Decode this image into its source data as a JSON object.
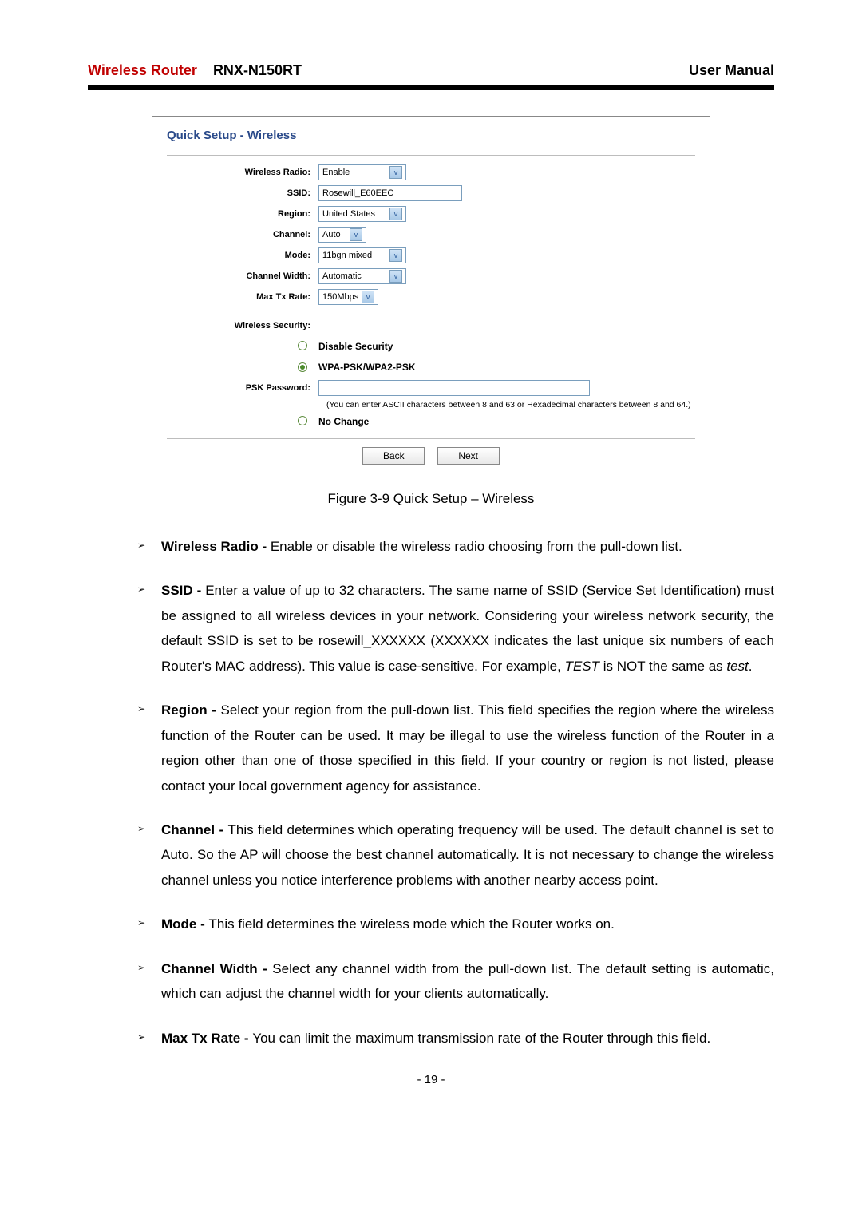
{
  "header": {
    "brand": "Wireless Router",
    "model": "RNX-N150RT",
    "right": "User Manual"
  },
  "figure": {
    "title": "Quick Setup - Wireless",
    "labels": {
      "wireless_radio": "Wireless Radio:",
      "ssid": "SSID:",
      "region": "Region:",
      "channel": "Channel:",
      "mode": "Mode:",
      "channel_width": "Channel Width:",
      "max_tx_rate": "Max Tx Rate:",
      "wireless_security": "Wireless Security:",
      "psk_password": "PSK Password:"
    },
    "values": {
      "wireless_radio": "Enable",
      "ssid": "Rosewill_E60EEC",
      "region": "United States",
      "channel": "Auto",
      "mode": "11bgn mixed",
      "channel_width": "Automatic",
      "max_tx_rate": "150Mbps"
    },
    "security": {
      "disable": "Disable Security",
      "wpa": "WPA-PSK/WPA2-PSK",
      "no_change": "No Change",
      "psk_value": "",
      "hint": "(You can enter ASCII characters between 8 and 63 or Hexadecimal characters between 8 and 64.)"
    },
    "buttons": {
      "back": "Back",
      "next": "Next"
    },
    "caption": "Figure 3-9    Quick Setup – Wireless"
  },
  "bullets": {
    "wireless_radio": {
      "label": "Wireless Radio - ",
      "text": "Enable or disable the wireless radio choosing from the pull-down list."
    },
    "ssid": {
      "label": "SSID - ",
      "text_a": "Enter a value of up to 32 characters. The same name of SSID (Service Set Identification) must be assigned to all wireless devices in your network. Considering your wireless network security, the default SSID is set to be rosewill_XXXXXX (XXXXXX indicates the last unique six numbers of each Router's MAC address). This value is case-sensitive. For example, ",
      "italic1": "TEST",
      "mid": " is NOT the same as ",
      "italic2": "test",
      "end": "."
    },
    "region": {
      "label": "Region - ",
      "text": "Select your region from the pull-down list. This field specifies the region where the wireless function of the Router can be used. It may be illegal to use the wireless function of the Router in a region other than one of those specified in this field. If your country or region is not listed, please contact your local government agency for assistance."
    },
    "channel": {
      "label": "Channel - ",
      "text": "This field determines which operating frequency will be used. The default channel is set to Auto. So the AP will choose the best channel automatically. It is not necessary to change the wireless channel unless you notice interference problems with another nearby access point."
    },
    "mode": {
      "label": "Mode - ",
      "text": "This field determines the wireless mode which the Router works on."
    },
    "channel_width": {
      "label": "Channel Width - ",
      "text": "Select any channel width from the pull-down list. The default setting is automatic, which can adjust the channel width for your clients automatically."
    },
    "max_tx_rate": {
      "label": "Max Tx Rate - ",
      "text": "You can limit the maximum transmission rate of the Router through this field."
    }
  },
  "page_number": "- 19 -"
}
